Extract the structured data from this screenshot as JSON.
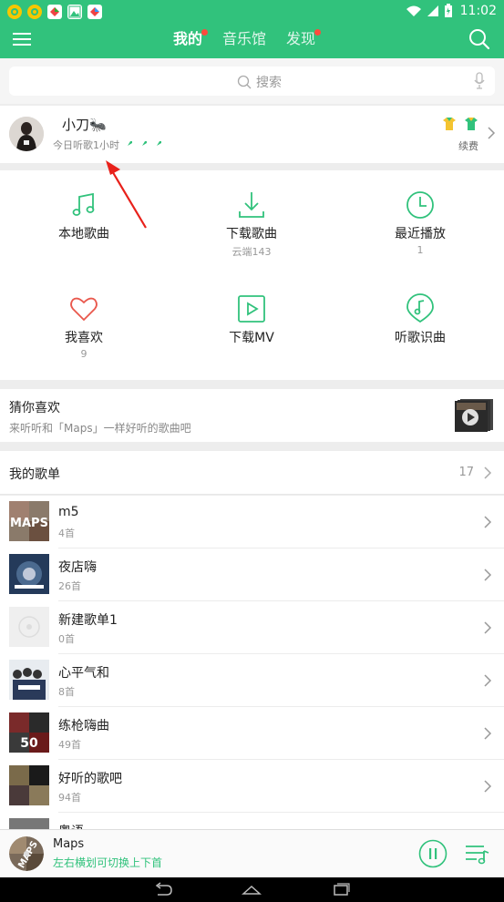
{
  "statusbar": {
    "time": "11:02",
    "app_icons": [
      "notification-app-icon",
      "notification-app-icon",
      "notification-app-icon",
      "photo-icon",
      "notification-app-icon"
    ]
  },
  "header": {
    "tabs": [
      {
        "label": "我的",
        "active": true,
        "dot": true
      },
      {
        "label": "音乐馆",
        "active": false,
        "dot": false
      },
      {
        "label": "发现",
        "active": false,
        "dot": true
      }
    ]
  },
  "search": {
    "placeholder": "搜索"
  },
  "profile": {
    "name": "小刀🐜",
    "listen_today": "今日听歌1小时",
    "renew": "续费"
  },
  "grid": {
    "items": [
      {
        "label": "本地歌曲",
        "sub": "",
        "icon": "music-note-icon"
      },
      {
        "label": "下载歌曲",
        "sub": "云端143",
        "icon": "download-icon"
      },
      {
        "label": "最近播放",
        "sub": "1",
        "icon": "clock-icon"
      },
      {
        "label": "我喜欢",
        "sub": "9",
        "icon": "heart-icon"
      },
      {
        "label": "下载MV",
        "sub": "",
        "icon": "video-play-icon"
      },
      {
        "label": "听歌识曲",
        "sub": "",
        "icon": "music-recognize-icon"
      }
    ]
  },
  "guess": {
    "title": "猜你喜欢",
    "subtitle": "来听听和「Maps」一样好听的歌曲吧"
  },
  "playlists": {
    "title": "我的歌单",
    "count": "17",
    "items": [
      {
        "name": "m5",
        "count": "4首"
      },
      {
        "name": "夜店嗨",
        "count": "26首"
      },
      {
        "name": "新建歌单1",
        "count": "0首"
      },
      {
        "name": "心平气和",
        "count": "8首"
      },
      {
        "name": "练枪嗨曲",
        "count": "49首"
      },
      {
        "name": "好听的歌吧",
        "count": "94首"
      },
      {
        "name": "粤语",
        "count": ""
      }
    ]
  },
  "player": {
    "song": "Maps",
    "hint": "左右横划可切换上下首"
  },
  "colors": {
    "accent": "#31c27c",
    "badge_red": "#ff4a3d"
  }
}
